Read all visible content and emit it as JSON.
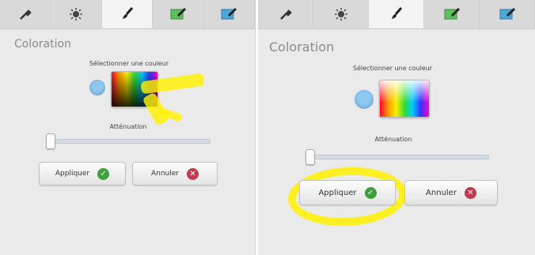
{
  "left": {
    "tabs": [
      {
        "icon": "wrench-icon"
      },
      {
        "icon": "sun-icon"
      },
      {
        "icon": "brush-icon",
        "active": true
      },
      {
        "icon": "edit-green-icon"
      },
      {
        "icon": "edit-blue-icon"
      }
    ],
    "title": "Coloration",
    "picker_label": "Sélectionner une couleur",
    "slider_label": "Atténuation",
    "slider_value": 0,
    "apply_label": "Appliquer",
    "cancel_label": "Annuler"
  },
  "right": {
    "tabs": [
      {
        "icon": "wrench-icon"
      },
      {
        "icon": "sun-icon"
      },
      {
        "icon": "brush-icon",
        "active": true
      },
      {
        "icon": "edit-green-icon"
      },
      {
        "icon": "edit-blue-icon"
      }
    ],
    "title": "Coloration",
    "picker_label": "Sélectionner une couleur",
    "slider_label": "Atténuation",
    "slider_value": 0,
    "apply_label": "Appliquer",
    "cancel_label": "Annuler"
  },
  "colors": {
    "highlight": "#fff100",
    "swatch": "#8ec8f0",
    "ok": "#3e9f3e",
    "cancel": "#c0394d"
  }
}
